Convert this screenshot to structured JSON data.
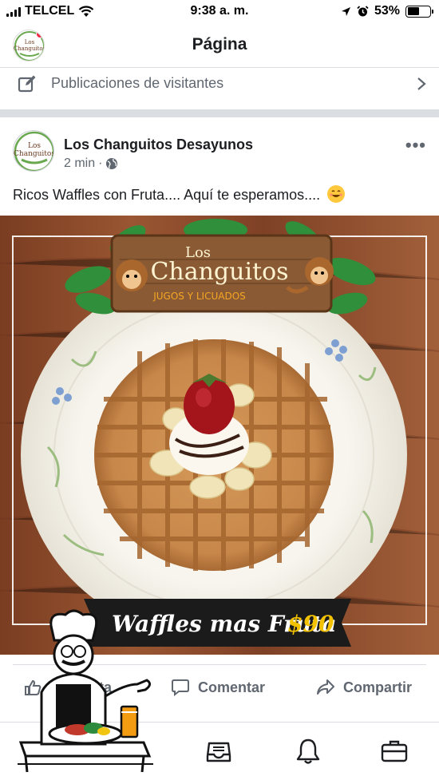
{
  "status_bar": {
    "carrier": "TELCEL",
    "time": "9:38 a. m.",
    "battery": "53%",
    "battery_level": 0.53
  },
  "header": {
    "title": "Página"
  },
  "visitor_posts": {
    "label": "Publicaciones de visitantes"
  },
  "post": {
    "author": "Los Changuitos Desayunos",
    "time_ago": "2 min",
    "separator": "·",
    "text": "Ricos Waffles con Fruta.... Aquí te esperamos....",
    "image": {
      "brand_top": "Los",
      "brand_main": "Changuitos",
      "brand_sub": "JUGOS Y LICUADOS",
      "banner_text": "Waffles mas Fruta",
      "price": "$90"
    }
  },
  "actions": {
    "like": "Me gusta",
    "comment": "Comentar",
    "share": "Compartir"
  },
  "avatar_text": {
    "line1": "Los",
    "line2": "Changuitos"
  },
  "colors": {
    "text": "#1c1e21",
    "secondary": "#606770",
    "separator": "#dadde1",
    "notification": "#f02849",
    "wood": "#8a4a2c",
    "leaf": "#2f8f3a",
    "banner": "#1b1b1b",
    "price": "#f2c200"
  },
  "icons": [
    "signal-icon",
    "wifi-icon",
    "location-icon",
    "alarm-icon",
    "battery-icon",
    "edit-icon",
    "chevron-right-icon",
    "globe-icon",
    "more-icon",
    "comment-icon",
    "share-icon",
    "home-icon",
    "inbox-icon",
    "bell-icon",
    "briefcase-icon",
    "chef-icon"
  ]
}
